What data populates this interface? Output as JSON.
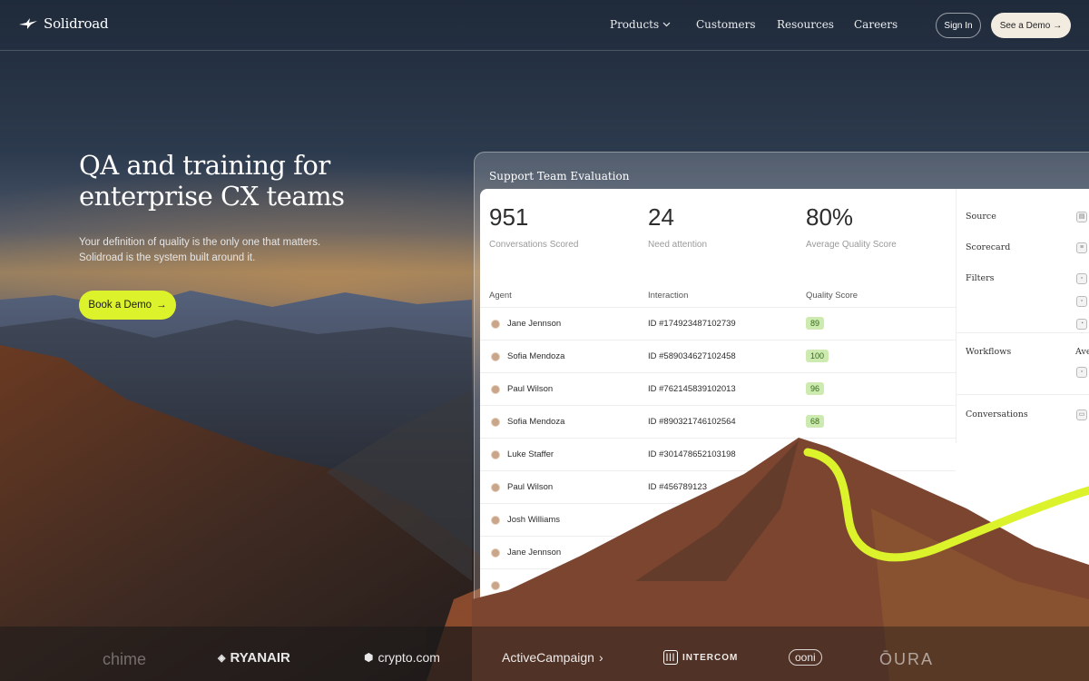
{
  "brand": {
    "name": "Solidroad"
  },
  "nav": {
    "links": [
      "Products",
      "Customers",
      "Resources",
      "Careers"
    ],
    "sign_in": "Sign In",
    "see_demo": "See a Demo"
  },
  "hero": {
    "title_line1": "QA and training for",
    "title_line2": "enterprise CX teams",
    "sub_line1": "Your definition of quality is the only one that matters.",
    "sub_line2": "Solidroad is the system built around it.",
    "cta": "Book a Demo"
  },
  "dashboard": {
    "title": "Support Team Evaluation",
    "stats": [
      {
        "value": "951",
        "label": "Conversations Scored"
      },
      {
        "value": "24",
        "label": "Need attention"
      },
      {
        "value": "80%",
        "label": "Average Quality Score"
      }
    ],
    "columns": [
      "Agent",
      "Interaction",
      "Quality Score"
    ],
    "rows": [
      {
        "agent": "Jane Jennson",
        "interaction": "ID #174923487102739",
        "score": "89"
      },
      {
        "agent": "Sofia Mendoza",
        "interaction": "ID #589034627102458",
        "score": "100"
      },
      {
        "agent": "Paul Wilson",
        "interaction": "ID #762145839102013",
        "score": "96"
      },
      {
        "agent": "Sofia Mendoza",
        "interaction": "ID #890321746102564",
        "score": "68"
      },
      {
        "agent": "Luke Staffer",
        "interaction": "ID #301478652103198",
        "score": ""
      },
      {
        "agent": "Paul Wilson",
        "interaction": "ID #456789123",
        "score": ""
      },
      {
        "agent": "Josh Williams",
        "interaction": "",
        "score": ""
      },
      {
        "agent": "Jane Jennson",
        "interaction": "",
        "score": ""
      }
    ],
    "sidebar": {
      "source": "Source",
      "scorecard": "Scorecard",
      "filters": "Filters",
      "workflows": "Workflows",
      "workflows_extra": "Ave",
      "conversations": "Conversations"
    }
  },
  "logos": [
    "chime",
    "RYANAIR",
    "crypto.com",
    "ActiveCampaign",
    "INTERCOM",
    "ooni",
    "ŌURA"
  ],
  "colors": {
    "accent": "#dcf22a",
    "demo_button": "#f2ece0",
    "score_badge": "#cdeab0"
  }
}
